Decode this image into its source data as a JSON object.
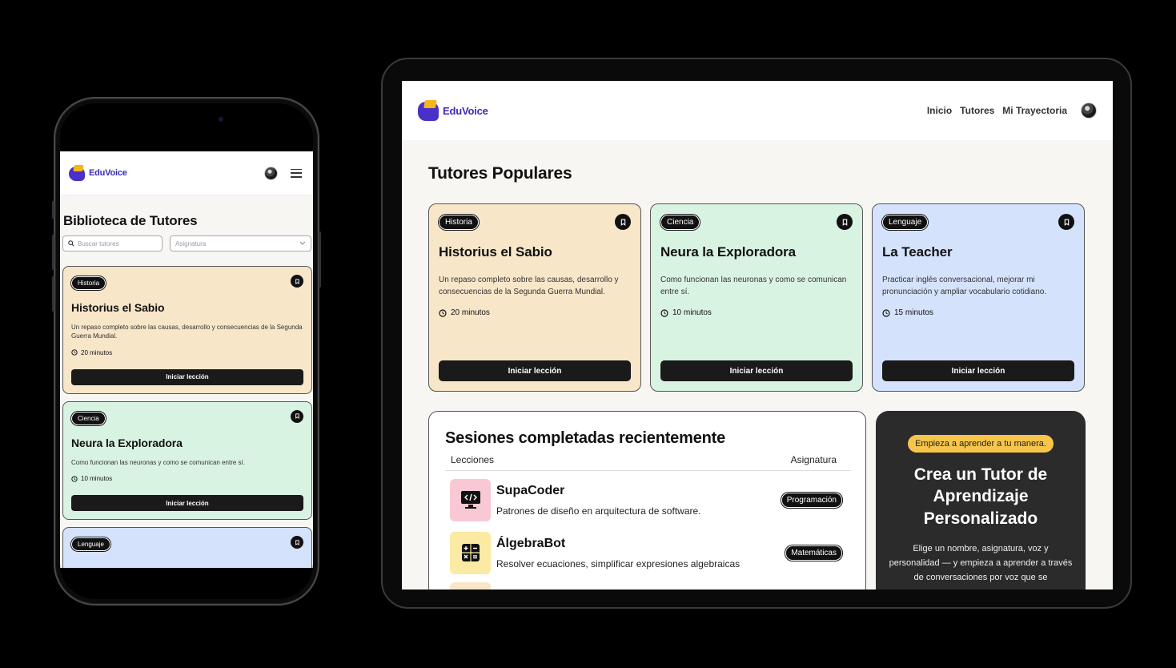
{
  "brand": {
    "name": "EduVoice",
    "primary": "#3a2ab8",
    "accent": "#f5b619"
  },
  "phone": {
    "page_title": "Biblioteca de Tutores",
    "search_placeholder": "Buscar tutores",
    "subject_select": "Asignatura",
    "cards": [
      {
        "badge": "Historia",
        "title": "Historius el Sabio",
        "desc": "Un repaso completo sobre las causas, desarrollo y consecuencias de la Segunda Guerra Mundial.",
        "duration": "20 minutos",
        "button": "Iniciar lección",
        "color": "#f8e6c9"
      },
      {
        "badge": "Ciencia",
        "title": "Neura la Exploradora",
        "desc": "Como funcionan las neuronas y como se comunican entre sí.",
        "duration": "10 minutos",
        "button": "Iniciar lección",
        "color": "#d9f3e2"
      },
      {
        "badge": "Lenguaje",
        "color": "#d4e2fc"
      }
    ]
  },
  "tablet": {
    "nav": [
      "Inicio",
      "Tutores",
      "Mi Trayectoria"
    ],
    "section_title": "Tutores Populares",
    "cards": [
      {
        "badge": "Historia",
        "title": "Historius el Sabio",
        "desc": "Un repaso completo sobre las causas, desarrollo y consecuencias de la Segunda Guerra Mundial.",
        "duration": "20 minutos",
        "button": "Iniciar lección"
      },
      {
        "badge": "Ciencia",
        "title": "Neura la Exploradora",
        "desc": "Como funcionan las neuronas y como se comunican entre sí.",
        "duration": "10 minutos",
        "button": "Iniciar lección"
      },
      {
        "badge": "Lenguaje",
        "title": "La Teacher",
        "desc": "Practicar inglés conversacional, mejorar mi pronunciación y ampliar vocabulario cotidiano.",
        "duration": "15 minutos",
        "button": "Iniciar lección"
      }
    ],
    "sessions": {
      "title": "Sesiones completadas recientemente",
      "col_lessons": "Lecciones",
      "col_subject": "Asignatura",
      "rows": [
        {
          "name": "SupaCoder",
          "desc": "Patrones de diseño en arquitectura de software.",
          "subject": "Programación",
          "icon": "code-monitor-icon",
          "color": "#f8c9d4"
        },
        {
          "name": "ÁlgebraBot",
          "desc": "Resolver ecuaciones, simplificar expresiones algebraicas",
          "subject": "Matemáticas",
          "icon": "calculator-icon",
          "color": "#fbeaa3"
        }
      ]
    },
    "promo": {
      "pill": "Empieza a aprender a tu manera.",
      "title": "Crea un Tutor de Aprendizaje Personalizado",
      "desc": "Elige un nombre, asignatura, voz y personalidad — y empieza a aprender a través de conversaciones por voz que se"
    }
  }
}
